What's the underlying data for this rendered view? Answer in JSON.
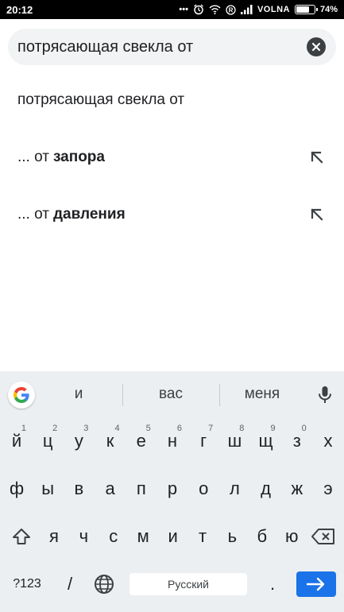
{
  "status_bar": {
    "time": "20:12",
    "dots": "•••",
    "carrier": "VOLNA",
    "battery_percent": "74%",
    "battery_level": 0.74,
    "icons": [
      "alarm-icon",
      "wifi-icon",
      "registered-icon",
      "signal-icon",
      "battery-icon"
    ]
  },
  "search": {
    "query": "потрясающая свекла от",
    "clear_icon": "close-icon"
  },
  "suggestions": [
    {
      "prefix": "потрясающая свекла от",
      "bold": "",
      "has_arrow": false
    },
    {
      "prefix": "... от",
      "bold": "запора",
      "has_arrow": true
    },
    {
      "prefix": "... от",
      "bold": "давления",
      "has_arrow": true
    }
  ],
  "keyboard": {
    "word_suggestions": [
      "и",
      "вас",
      "меня"
    ],
    "row1": [
      {
        "key": "й",
        "hint": "1"
      },
      {
        "key": "ц",
        "hint": "2"
      },
      {
        "key": "у",
        "hint": "3"
      },
      {
        "key": "к",
        "hint": "4"
      },
      {
        "key": "е",
        "hint": "5"
      },
      {
        "key": "н",
        "hint": "6"
      },
      {
        "key": "г",
        "hint": "7"
      },
      {
        "key": "ш",
        "hint": "8"
      },
      {
        "key": "щ",
        "hint": "9"
      },
      {
        "key": "з",
        "hint": "0"
      },
      {
        "key": "х",
        "hint": ""
      }
    ],
    "row2": [
      "ф",
      "ы",
      "в",
      "а",
      "п",
      "р",
      "о",
      "л",
      "д",
      "ж",
      "э"
    ],
    "row3": [
      "я",
      "ч",
      "с",
      "м",
      "и",
      "т",
      "ь",
      "б",
      "ю"
    ],
    "symbols_label": "?123",
    "slash_label": "/",
    "space_label": "Русский",
    "period_label": ".",
    "accent_color": "#1a73e8"
  }
}
